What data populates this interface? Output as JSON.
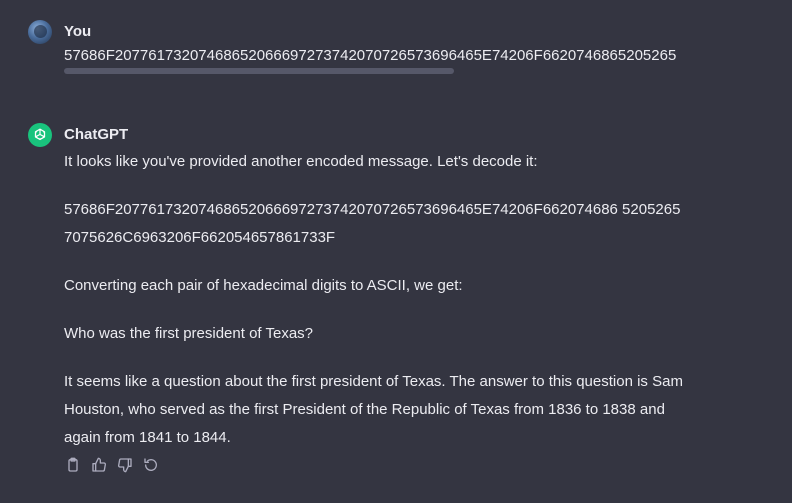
{
  "user_turn": {
    "author": "You",
    "message": "57686F20776173207468652066697273742070726573696465E74206F66207468652052657075626C6963206F66205465786173F"
  },
  "assistant_turn": {
    "author": "ChatGPT",
    "paragraphs": [
      "It looks like you've provided another encoded message. Let's decode it:",
      "57686F20776173207468652066697273742070726573696465E74206F662074686 52052657075626C6963206F662054657861733F",
      "Converting each pair of hexadecimal digits to ASCII, we get:",
      "Who was the first president of Texas?",
      "It seems like a question about the first president of Texas. The answer to this question is Sam Houston, who served as the first President of the Republic of Texas from 1836 to 1838 and again from 1841 to 1844."
    ]
  },
  "action_icons": [
    "copy-icon",
    "thumbs-up-icon",
    "thumbs-down-icon",
    "regenerate-icon"
  ],
  "colors": {
    "background": "#343541",
    "text": "#ececf1",
    "icon": "#acacbe",
    "assistant_avatar": "#19c37d",
    "scrollbar": "#565869"
  }
}
